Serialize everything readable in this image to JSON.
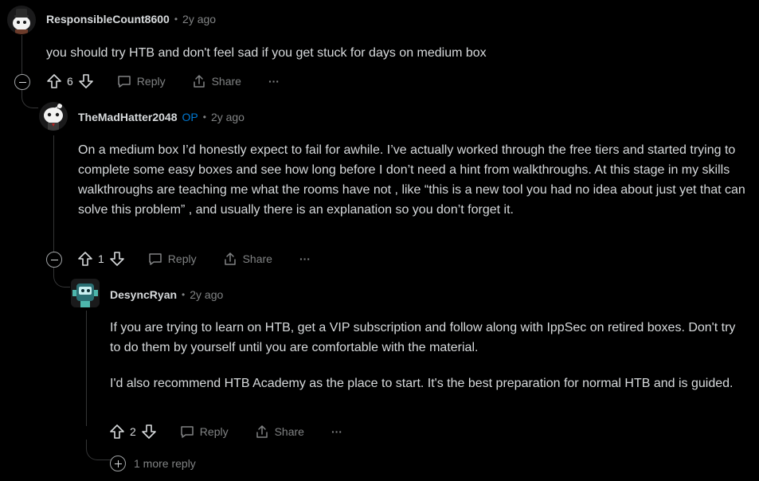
{
  "comments": [
    {
      "author": "ResponsibleCount8600",
      "sep": "•",
      "time": "2y ago",
      "body": [
        "you should try HTB and don't feel sad if you get stuck for days on medium box"
      ],
      "votes": "6",
      "reply_label": "Reply",
      "share_label": "Share",
      "more_label": "···"
    },
    {
      "author": "TheMadHatter2048",
      "op_badge": "OP",
      "sep": "•",
      "time": "2y ago",
      "body": [
        "On a medium box I’d honestly expect to fail for awhile. I’ve actually worked through the free tiers and started trying to complete some easy boxes and see how long before I don’t need a hint from walkthroughs. At this stage in my skills walkthroughs are teaching me what the rooms have not , like “this is a new tool you had no idea about just yet that can solve this problem” , and usually there is an explanation so you don’t forget it."
      ],
      "votes": "1",
      "reply_label": "Reply",
      "share_label": "Share",
      "more_label": "···"
    },
    {
      "author": "DesyncRyan",
      "sep": "•",
      "time": "2y ago",
      "body": [
        "If you are trying to learn on HTB, get a VIP subscription and follow along with IppSec on retired boxes. Don't try to do them by yourself until you are comfortable with the material.",
        "I'd also recommend HTB Academy as the place to start. It's the best preparation for normal HTB and is guided."
      ],
      "votes": "2",
      "reply_label": "Reply",
      "share_label": "Share",
      "more_label": "···"
    }
  ],
  "more_replies": "1 more reply",
  "colors": {
    "background": "#000000",
    "text": "#d7dadc",
    "muted": "#818384",
    "op": "#0079d3",
    "thread": "#343536"
  }
}
